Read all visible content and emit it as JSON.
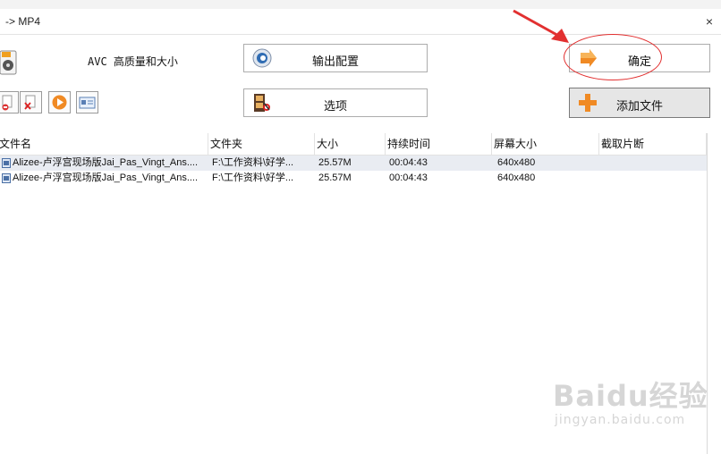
{
  "window": {
    "title": "-> MP4",
    "close_glyph": "×"
  },
  "preset_label": "AVC 高质量和大小",
  "buttons": {
    "output_config": "输出配置",
    "options": "选项",
    "ok": "确定",
    "add_file": "添加文件"
  },
  "toolbar_icons": [
    "remove-icon",
    "clear-icon",
    "play-icon",
    "info-icon"
  ],
  "table": {
    "columns": [
      "文件名",
      "文件夹",
      "大小",
      "持续时间",
      "屏幕大小",
      "截取片断"
    ],
    "rows": [
      [
        "Alizee-卢浮宫现场版Jai_Pas_Vingt_Ans....",
        "F:\\工作资料\\好学...",
        "25.57M",
        "00:04:43",
        "640x480",
        ""
      ],
      [
        "Alizee-卢浮宫现场版Jai_Pas_Vingt_Ans....",
        "F:\\工作资料\\好学...",
        "25.57M",
        "00:04:43",
        "640x480",
        ""
      ]
    ]
  },
  "watermark": {
    "top": "Baidu经验",
    "bottom": "jingyan.baidu.com"
  },
  "colors": {
    "annotation_red": "#e23030",
    "accent_orange": "#f08a24"
  }
}
